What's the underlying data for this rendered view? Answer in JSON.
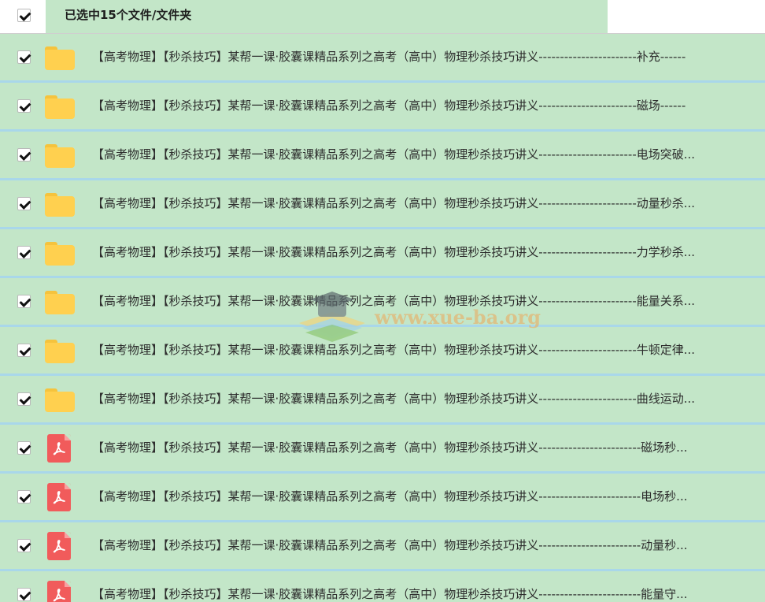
{
  "header": {
    "select_all_checked": true,
    "title": "已选中15个文件/文件夹"
  },
  "rows": [
    {
      "type": "folder",
      "icon": "folder-icon",
      "checked": true,
      "name": "【高考物理】【秒杀技巧】某帮一课·胶囊课精品系列之高考（高中）物理秒杀技巧讲义-----------------------补充------"
    },
    {
      "type": "folder",
      "icon": "folder-icon",
      "checked": true,
      "name": "【高考物理】【秒杀技巧】某帮一课·胶囊课精品系列之高考（高中）物理秒杀技巧讲义-----------------------磁场------"
    },
    {
      "type": "folder",
      "icon": "folder-icon",
      "checked": true,
      "name": "【高考物理】【秒杀技巧】某帮一课·胶囊课精品系列之高考（高中）物理秒杀技巧讲义-----------------------电场突破..."
    },
    {
      "type": "folder",
      "icon": "folder-icon",
      "checked": true,
      "name": "【高考物理】【秒杀技巧】某帮一课·胶囊课精品系列之高考（高中）物理秒杀技巧讲义-----------------------动量秒杀..."
    },
    {
      "type": "folder",
      "icon": "folder-icon",
      "checked": true,
      "name": "【高考物理】【秒杀技巧】某帮一课·胶囊课精品系列之高考（高中）物理秒杀技巧讲义-----------------------力学秒杀..."
    },
    {
      "type": "folder",
      "icon": "folder-icon",
      "checked": true,
      "name": "【高考物理】【秒杀技巧】某帮一课·胶囊课精品系列之高考（高中）物理秒杀技巧讲义-----------------------能量关系..."
    },
    {
      "type": "folder",
      "icon": "folder-icon",
      "checked": true,
      "name": "【高考物理】【秒杀技巧】某帮一课·胶囊课精品系列之高考（高中）物理秒杀技巧讲义-----------------------牛顿定律..."
    },
    {
      "type": "folder",
      "icon": "folder-icon",
      "checked": true,
      "name": "【高考物理】【秒杀技巧】某帮一课·胶囊课精品系列之高考（高中）物理秒杀技巧讲义-----------------------曲线运动..."
    },
    {
      "type": "pdf",
      "icon": "pdf-file-icon",
      "checked": true,
      "name": "【高考物理】【秒杀技巧】某帮一课·胶囊课精品系列之高考（高中）物理秒杀技巧讲义------------------------磁场秒..."
    },
    {
      "type": "pdf",
      "icon": "pdf-file-icon",
      "checked": true,
      "name": "【高考物理】【秒杀技巧】某帮一课·胶囊课精品系列之高考（高中）物理秒杀技巧讲义------------------------电场秒..."
    },
    {
      "type": "pdf",
      "icon": "pdf-file-icon",
      "checked": true,
      "name": "【高考物理】【秒杀技巧】某帮一课·胶囊课精品系列之高考（高中）物理秒杀技巧讲义------------------------动量秒..."
    },
    {
      "type": "pdf",
      "icon": "pdf-file-icon",
      "checked": true,
      "name": "【高考物理】【秒杀技巧】某帮一课·胶囊课精品系列之高考（高中）物理秒杀技巧讲义------------------------能量守..."
    }
  ],
  "watermark": {
    "text": "www.xue-ba.org",
    "icon": "graduation-cap-book-icon"
  },
  "colors": {
    "row_background": "#c3e6c8",
    "row_separator": "#a9d7ea",
    "folder": "#ffd04f",
    "pdf": "#f15b5b",
    "watermark_text": "#e2b876"
  }
}
